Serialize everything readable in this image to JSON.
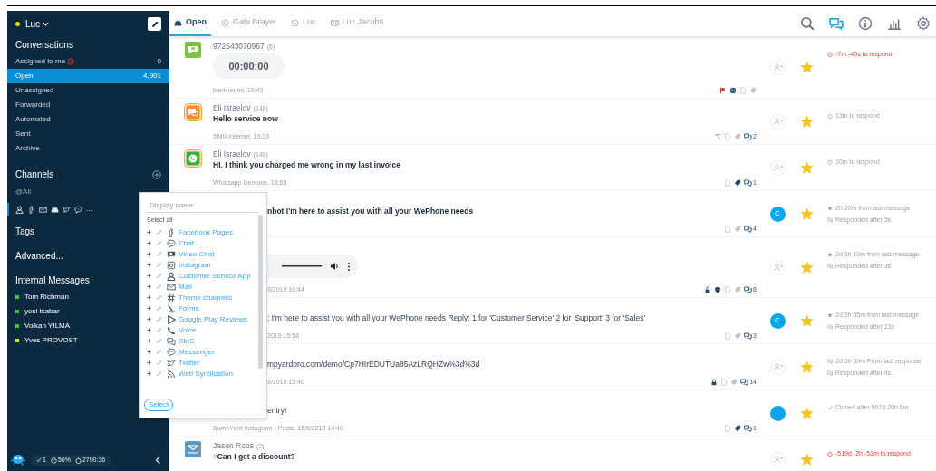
{
  "sidebar": {
    "user": {
      "name": "Luc",
      "color": "#e8e000"
    },
    "conversations": {
      "title": "Conversations",
      "items": [
        {
          "label": "Assigned to me",
          "alert": true,
          "count": "0",
          "selected": false
        },
        {
          "label": "Open",
          "alert": false,
          "count": "4,901",
          "selected": true
        },
        {
          "label": "Unassigned",
          "alert": false,
          "selected": false
        },
        {
          "label": "Forwarded",
          "alert": false,
          "selected": false
        },
        {
          "label": "Automated",
          "alert": false,
          "selected": false
        },
        {
          "label": "Sent",
          "alert": false,
          "selected": false
        },
        {
          "label": "Archive",
          "alert": false,
          "selected": false
        }
      ]
    },
    "channels": {
      "title": "Channels",
      "all": "@All",
      "icons": [
        {
          "kind": "person"
        },
        {
          "kind": "page"
        },
        {
          "kind": "envelope"
        },
        {
          "kind": "inbox"
        },
        {
          "kind": "bird"
        },
        {
          "kind": "bubble"
        }
      ],
      "more": "..."
    },
    "tags": "Tags",
    "advanced": "Advanced...",
    "internal": {
      "title": "Internal Messages",
      "users": [
        {
          "name": "Tom Richman",
          "color": "#22cc33"
        },
        {
          "name": "yosi tsabar",
          "color": "#22cc33"
        },
        {
          "name": "Volkan YILMA",
          "color": "#22cc33"
        },
        {
          "name": "Yves PROVOST",
          "color": "#e8e000"
        }
      ]
    },
    "status": {
      "checks": "1",
      "percent": "50%",
      "timer": "2790:36"
    }
  },
  "tabs": [
    {
      "label": "Open",
      "kind": "inbox",
      "selected": true
    },
    {
      "label": "Gabi Brayer",
      "kind": "phone-bubble",
      "selected": false
    },
    {
      "label": "Luc",
      "kind": "phone-bubble",
      "selected": false
    },
    {
      "label": "Luc Jacobs",
      "kind": "envelope",
      "selected": false
    }
  ],
  "toolbar": [
    {
      "kind": "search",
      "selected": false
    },
    {
      "kind": "chat",
      "selected": true
    },
    {
      "kind": "info",
      "selected": false
    },
    {
      "kind": "chart",
      "selected": false
    },
    {
      "kind": "settings",
      "selected": false
    }
  ],
  "rows": [
    {
      "kind": "sms-green",
      "name": "972543070967",
      "count": "(6)",
      "content": {
        "kind": "call",
        "text": "00:00:00"
      },
      "meta": "bank leumi, 19:43",
      "footer": [
        {
          "kind": "flag"
        },
        {
          "kind": "globe"
        },
        {
          "kind": "note"
        },
        {
          "kind": "tag"
        }
      ],
      "assignee": {
        "kind": "empty"
      },
      "starred": true,
      "sla": {
        "overdue": true,
        "lines": [
          {
            "kind": "timer",
            "text": "-7m -40s to respond"
          }
        ]
      }
    },
    {
      "kind": "sms-orange",
      "name": "Eli Israelov",
      "count": "(148)",
      "content": {
        "kind": "text",
        "bold": true,
        "text": "Hello service now"
      },
      "meta": "SMS Internet, 19:39",
      "footer": [
        {
          "kind": "branch"
        },
        {
          "kind": "note"
        },
        {
          "kind": "tag"
        },
        {
          "kind": "chats",
          "count": "2"
        }
      ],
      "assignee": {
        "kind": "empty"
      },
      "starred": true,
      "sla": {
        "overdue": false,
        "lines": [
          {
            "kind": "timer",
            "text": "13m to respond"
          }
        ]
      }
    },
    {
      "kind": "whatsapp",
      "name": "Eli Israelov",
      "count": "(148)",
      "content": {
        "kind": "text",
        "bold": true,
        "text": "HI. I think you charged me wrong in my last invoice"
      },
      "meta": "Whatsapp Demoen, 18:55",
      "footer": [
        {
          "kind": "note"
        },
        {
          "kind": "tag-dark"
        },
        {
          "kind": "chats",
          "count": "1"
        }
      ],
      "assignee": {
        "kind": "empty"
      },
      "starred": true,
      "sla": {
        "overdue": false,
        "lines": [
          {
            "kind": "timer",
            "text": "10m to respond"
          }
        ]
      }
    },
    {
      "content": {
        "kind": "text",
        "bold": true,
        "text": "nbot I'm here to assist you with all your WePhone needs"
      },
      "footer": [
        {
          "kind": "note"
        },
        {
          "kind": "tag"
        },
        {
          "kind": "chats",
          "count": "4"
        }
      ],
      "assignee": {
        "kind": "initial",
        "text": "C"
      },
      "starred": true,
      "sla": {
        "overdue": false,
        "lines": [
          {
            "kind": "star",
            "text": "2h 20m from last message"
          },
          {
            "kind": "chat",
            "text": "Responded after 3s"
          }
        ]
      }
    },
    {
      "content": {
        "kind": "audio"
      },
      "meta": "9/2019 16:44",
      "footer": [
        {
          "kind": "lock"
        },
        {
          "kind": "shield"
        },
        {
          "kind": "note"
        },
        {
          "kind": "tag"
        },
        {
          "kind": "chats",
          "count": "8"
        }
      ],
      "assignee": {
        "kind": "empty"
      },
      "starred": true,
      "sla": {
        "overdue": false,
        "lines": [
          {
            "kind": "star",
            "text": "2d 3h 10m from last message"
          },
          {
            "kind": "chat",
            "text": "Responded after 3s"
          }
        ]
      }
    },
    {
      "content": {
        "kind": "text",
        "bold": false,
        "text": ": I'm here to assist you with all your WePhone needs Reply: 1 for 'Customer Service' 2 for 'Support' 3 for 'Sales'"
      },
      "meta": "2019 15:58",
      "footer": [
        {
          "kind": "note"
        },
        {
          "kind": "tag"
        },
        {
          "kind": "chats",
          "count": "3"
        }
      ],
      "assignee": {
        "kind": "initial",
        "text": "C"
      },
      "starred": true,
      "sla": {
        "overdue": false,
        "lines": [
          {
            "kind": "star",
            "text": "2d 3h 55m from last message"
          },
          {
            "kind": "chat",
            "text": "Responded after 23s"
          }
        ]
      }
    },
    {
      "content": {
        "kind": "text",
        "bold": false,
        "text": "mpyardpro.com/demo/Cp7HIrEDUTUa85AzLRQHZw%3d%3d"
      },
      "meta": "9/2019 15:40",
      "footer": [
        {
          "kind": "lock"
        },
        {
          "kind": "note"
        },
        {
          "kind": "tag"
        },
        {
          "kind": "chats",
          "count": "14"
        }
      ],
      "assignee": {
        "kind": "empty"
      },
      "starred": true,
      "sla": {
        "overdue": false,
        "lines": [
          {
            "kind": "chat",
            "text": "2d 3h 59m From last response"
          },
          {
            "kind": "chat",
            "text": "Responded after 4s"
          }
        ]
      }
    },
    {
      "content": {
        "kind": "text",
        "bold": false,
        "text": "entry!"
      },
      "meta": "BumpYard Instagram - Posts, 15/8/2018 14:40",
      "footer": [
        {
          "kind": "note"
        },
        {
          "kind": "tag-dark"
        },
        {
          "kind": "chats",
          "count": "1"
        }
      ],
      "assignee": {
        "kind": "filled"
      },
      "starred": true,
      "sla": {
        "overdue": false,
        "lines": [
          {
            "kind": "check",
            "text": "Closed after 567d 20h 8m"
          }
        ]
      }
    },
    {
      "kind": "mail",
      "name": "Jason Roos",
      "count": "(2)",
      "content": {
        "kind": "text",
        "bold": true,
        "prefix": "#",
        "text": "Can I get a discount?"
      },
      "footer": [],
      "assignee": {
        "kind": "empty"
      },
      "starred": true,
      "sla": {
        "overdue": true,
        "lines": [
          {
            "kind": "timer",
            "text": "-519d -2h -52m to respond"
          }
        ]
      }
    }
  ],
  "channel_picker": {
    "placeholder": "Display name",
    "select_all": "Select all",
    "items": [
      {
        "label": "Facebook Pages",
        "kind": "page",
        "checked": true
      },
      {
        "label": "Chat",
        "kind": "bubble",
        "checked": true
      },
      {
        "label": "Video Chat",
        "kind": "video",
        "checked": true
      },
      {
        "label": "Instagram",
        "kind": "camera",
        "checked": true
      },
      {
        "label": "Customer Service App",
        "kind": "person",
        "checked": true
      },
      {
        "label": "Mail",
        "kind": "envelope",
        "checked": true
      },
      {
        "label": "Theme channels",
        "kind": "hash",
        "checked": true
      },
      {
        "label": "Forms",
        "kind": "pen",
        "checked": true
      },
      {
        "label": "Google Play Reviews",
        "kind": "play",
        "checked": true
      },
      {
        "label": "Voice",
        "kind": "phone",
        "checked": true
      },
      {
        "label": "SMS",
        "kind": "bubbles",
        "checked": true
      },
      {
        "label": "Messenger",
        "kind": "bubble",
        "checked": true
      },
      {
        "label": "Twitter",
        "kind": "bird",
        "checked": true
      },
      {
        "label": "Web Syndication",
        "kind": "rss",
        "checked": true
      }
    ],
    "button": "Select"
  }
}
